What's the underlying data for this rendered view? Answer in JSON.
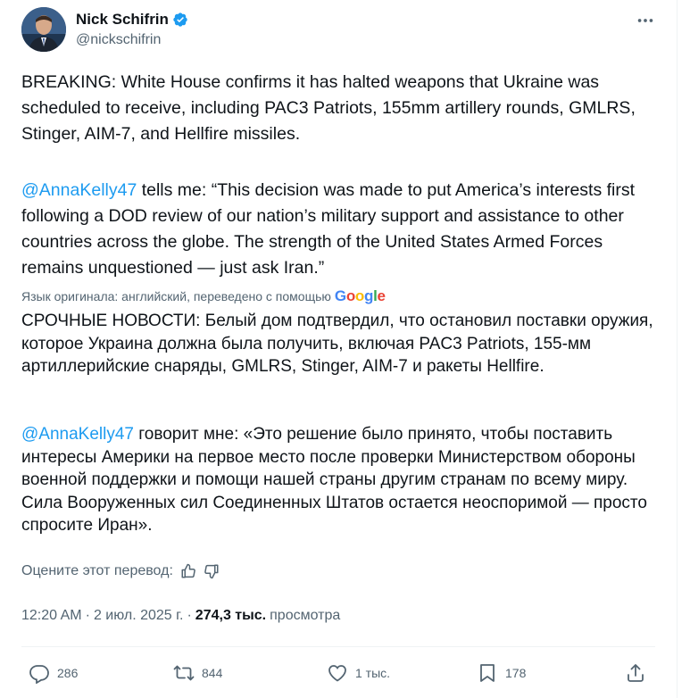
{
  "author": {
    "name": "Nick Schifrin",
    "handle": "@nickschifrin"
  },
  "tweet": {
    "p1": "BREAKING: White House confirms it has halted weapons that Ukraine was scheduled to receive, including PAC3 Patriots, 155mm artillery rounds, GMLRS, Stinger, AIM-7, and Hellfire missiles.",
    "p2_mention": "@AnnaKelly47",
    "p2_text": " tells me: “This decision was made to put America’s interests first following a DOD review of our nation’s military support and assistance to other countries across the globe. The strength of the United States Armed Forces remains unquestioned — just ask Iran.”"
  },
  "translation": {
    "note": "Язык оригинала: английский, переведено с помощью",
    "google": "Google",
    "p1": "СРОЧНЫЕ НОВОСТИ: Белый дом подтвердил, что остановил поставки оружия, которое Украина должна была получить, включая PAC3 Patriots, 155-мм артиллерийские снаряды, GMLRS, Stinger, AIM-7 и ракеты Hellfire.",
    "p2_mention": "@AnnaKelly47",
    "p2_text": " говорит мне: «Это решение было принято, чтобы поставить интересы Америки на первое место после проверки Министерством обороны военной поддержки и помощи нашей страны другим странам по всему миру. Сила Вооруженных сил Соединенных Штатов остается неоспоримой — просто спросите Иран».",
    "rate_label": "Оцените этот перевод:"
  },
  "meta": {
    "time": "12:20 AM",
    "sep": "·",
    "date": "2 июл. 2025 г.",
    "sep2": "·",
    "views_count": "274,3 тыс.",
    "views_label": "просмотра"
  },
  "actions": {
    "replies": "286",
    "reposts": "844",
    "likes": "1 тыс.",
    "bookmarks": "178"
  },
  "colors": {
    "accent": "#1d9bf0",
    "secondary_text": "#536471",
    "primary_text": "#0f1419"
  }
}
